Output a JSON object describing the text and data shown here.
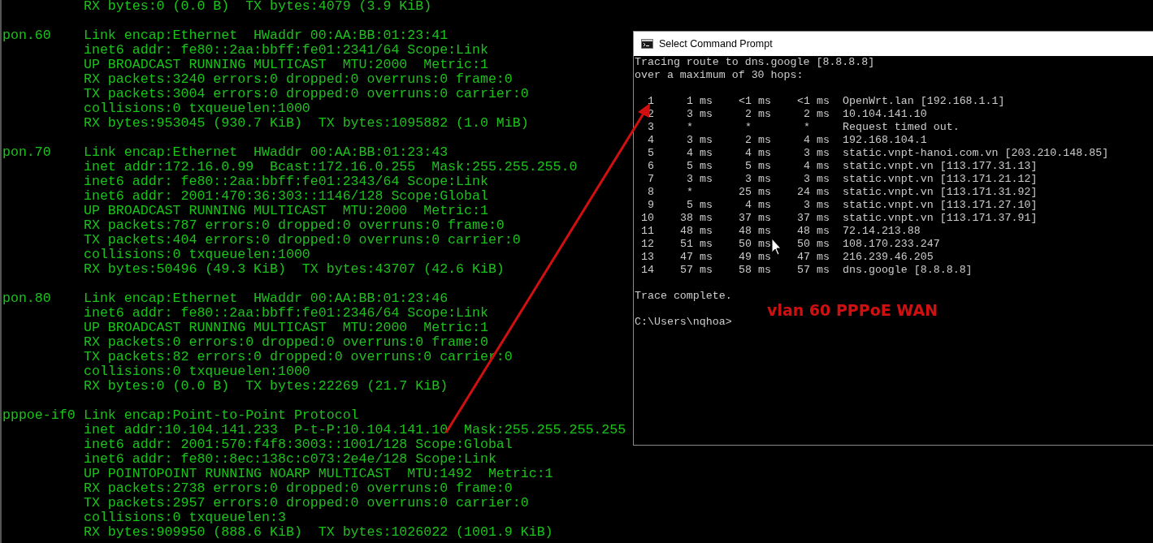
{
  "terminal": {
    "blocks": [
      {
        "lines": [
          "RX bytes:0 (0.0 B)  TX bytes:4079 (3.9 KiB)"
        ]
      },
      {
        "interface": "pon.60",
        "lines": [
          "Link encap:Ethernet  HWaddr 00:AA:BB:01:23:41",
          "inet6 addr: fe80::2aa:bbff:fe01:2341/64 Scope:Link",
          "UP BROADCAST RUNNING MULTICAST  MTU:2000  Metric:1",
          "RX packets:3240 errors:0 dropped:0 overruns:0 frame:0",
          "TX packets:3004 errors:0 dropped:0 overruns:0 carrier:0",
          "collisions:0 txqueuelen:1000",
          "RX bytes:953045 (930.7 KiB)  TX bytes:1095882 (1.0 MiB)"
        ]
      },
      {
        "interface": "pon.70",
        "lines": [
          "Link encap:Ethernet  HWaddr 00:AA:BB:01:23:43",
          "inet addr:172.16.0.99  Bcast:172.16.0.255  Mask:255.255.255.0",
          "inet6 addr: fe80::2aa:bbff:fe01:2343/64 Scope:Link",
          "inet6 addr: 2001:470:36:303::1146/128 Scope:Global",
          "UP BROADCAST RUNNING MULTICAST  MTU:2000  Metric:1",
          "RX packets:787 errors:0 dropped:0 overruns:0 frame:0",
          "TX packets:404 errors:0 dropped:0 overruns:0 carrier:0",
          "collisions:0 txqueuelen:1000",
          "RX bytes:50496 (49.3 KiB)  TX bytes:43707 (42.6 KiB)"
        ]
      },
      {
        "interface": "pon.80",
        "lines": [
          "Link encap:Ethernet  HWaddr 00:AA:BB:01:23:46",
          "inet6 addr: fe80::2aa:bbff:fe01:2346/64 Scope:Link",
          "UP BROADCAST RUNNING MULTICAST  MTU:2000  Metric:1",
          "RX packets:0 errors:0 dropped:0 overruns:0 frame:0",
          "TX packets:82 errors:0 dropped:0 overruns:0 carrier:0",
          "collisions:0 txqueuelen:1000",
          "RX bytes:0 (0.0 B)  TX bytes:22269 (21.7 KiB)"
        ]
      },
      {
        "interface": "pppoe-if0",
        "lines": [
          "Link encap:Point-to-Point Protocol",
          "inet addr:10.104.141.233  P-t-P:10.104.141.10  Mask:255.255.255.255",
          "inet6 addr: 2001:570:f4f8:3003::1001/128 Scope:Global",
          "inet6 addr: fe80::8ec:138c:c073:2e4e/128 Scope:Link",
          "UP POINTOPOINT RUNNING NOARP MULTICAST  MTU:1492  Metric:1",
          "RX packets:2738 errors:0 dropped:0 overruns:0 frame:0",
          "TX packets:2957 errors:0 dropped:0 overruns:0 carrier:0",
          "collisions:0 txqueuelen:3",
          "RX bytes:909950 (888.6 KiB)  TX bytes:1026022 (1001.9 KiB)"
        ]
      }
    ]
  },
  "cmd_window": {
    "title": "Select Command Prompt",
    "header_lines": [
      "Tracing route to dns.google [8.8.8.8]",
      "over a maximum of 30 hops:"
    ],
    "hops": [
      {
        "hop": "1",
        "times": [
          {
            "value": "1",
            "unit": "ms"
          },
          {
            "value": "<1",
            "unit": "ms"
          },
          {
            "value": "<1",
            "unit": "ms"
          }
        ],
        "host": "OpenWrt.lan [192.168.1.1]"
      },
      {
        "hop": "2",
        "times": [
          {
            "value": "3",
            "unit": "ms"
          },
          {
            "value": "2",
            "unit": "ms"
          },
          {
            "value": "2",
            "unit": "ms"
          }
        ],
        "host": "10.104.141.10"
      },
      {
        "hop": "3",
        "times": [
          {
            "value": "*"
          },
          {
            "value": "*"
          },
          {
            "value": "*"
          }
        ],
        "host": "Request timed out."
      },
      {
        "hop": "4",
        "times": [
          {
            "value": "3",
            "unit": "ms"
          },
          {
            "value": "2",
            "unit": "ms"
          },
          {
            "value": "4",
            "unit": "ms"
          }
        ],
        "host": "192.168.104.1"
      },
      {
        "hop": "5",
        "times": [
          {
            "value": "4",
            "unit": "ms"
          },
          {
            "value": "4",
            "unit": "ms"
          },
          {
            "value": "3",
            "unit": "ms"
          }
        ],
        "host": "static.vnpt-hanoi.com.vn [203.210.148.85]"
      },
      {
        "hop": "6",
        "times": [
          {
            "value": "5",
            "unit": "ms"
          },
          {
            "value": "5",
            "unit": "ms"
          },
          {
            "value": "4",
            "unit": "ms"
          }
        ],
        "host": "static.vnpt.vn [113.177.31.13]"
      },
      {
        "hop": "7",
        "times": [
          {
            "value": "3",
            "unit": "ms"
          },
          {
            "value": "3",
            "unit": "ms"
          },
          {
            "value": "3",
            "unit": "ms"
          }
        ],
        "host": "static.vnpt.vn [113.171.21.12]"
      },
      {
        "hop": "8",
        "times": [
          {
            "value": "*"
          },
          {
            "value": "25",
            "unit": "ms"
          },
          {
            "value": "24",
            "unit": "ms"
          }
        ],
        "host": "static.vnpt.vn [113.171.31.92]"
      },
      {
        "hop": "9",
        "times": [
          {
            "value": "5",
            "unit": "ms"
          },
          {
            "value": "4",
            "unit": "ms"
          },
          {
            "value": "3",
            "unit": "ms"
          }
        ],
        "host": "static.vnpt.vn [113.171.27.10]"
      },
      {
        "hop": "10",
        "times": [
          {
            "value": "38",
            "unit": "ms"
          },
          {
            "value": "37",
            "unit": "ms"
          },
          {
            "value": "37",
            "unit": "ms"
          }
        ],
        "host": "static.vnpt.vn [113.171.37.91]"
      },
      {
        "hop": "11",
        "times": [
          {
            "value": "48",
            "unit": "ms"
          },
          {
            "value": "48",
            "unit": "ms"
          },
          {
            "value": "48",
            "unit": "ms"
          }
        ],
        "host": "72.14.213.88"
      },
      {
        "hop": "12",
        "times": [
          {
            "value": "51",
            "unit": "ms"
          },
          {
            "value": "50",
            "unit": "ms"
          },
          {
            "value": "50",
            "unit": "ms"
          }
        ],
        "host": "108.170.233.247"
      },
      {
        "hop": "13",
        "times": [
          {
            "value": "47",
            "unit": "ms"
          },
          {
            "value": "49",
            "unit": "ms"
          },
          {
            "value": "47",
            "unit": "ms"
          }
        ],
        "host": "216.239.46.205"
      },
      {
        "hop": "14",
        "times": [
          {
            "value": "57",
            "unit": "ms"
          },
          {
            "value": "58",
            "unit": "ms"
          },
          {
            "value": "57",
            "unit": "ms"
          }
        ],
        "host": "dns.google [8.8.8.8]"
      }
    ],
    "footer": "Trace complete.",
    "prompt": "C:\\Users\\nqhoa>"
  },
  "annotation": {
    "label": "vlan 60 PPPoE WAN"
  }
}
